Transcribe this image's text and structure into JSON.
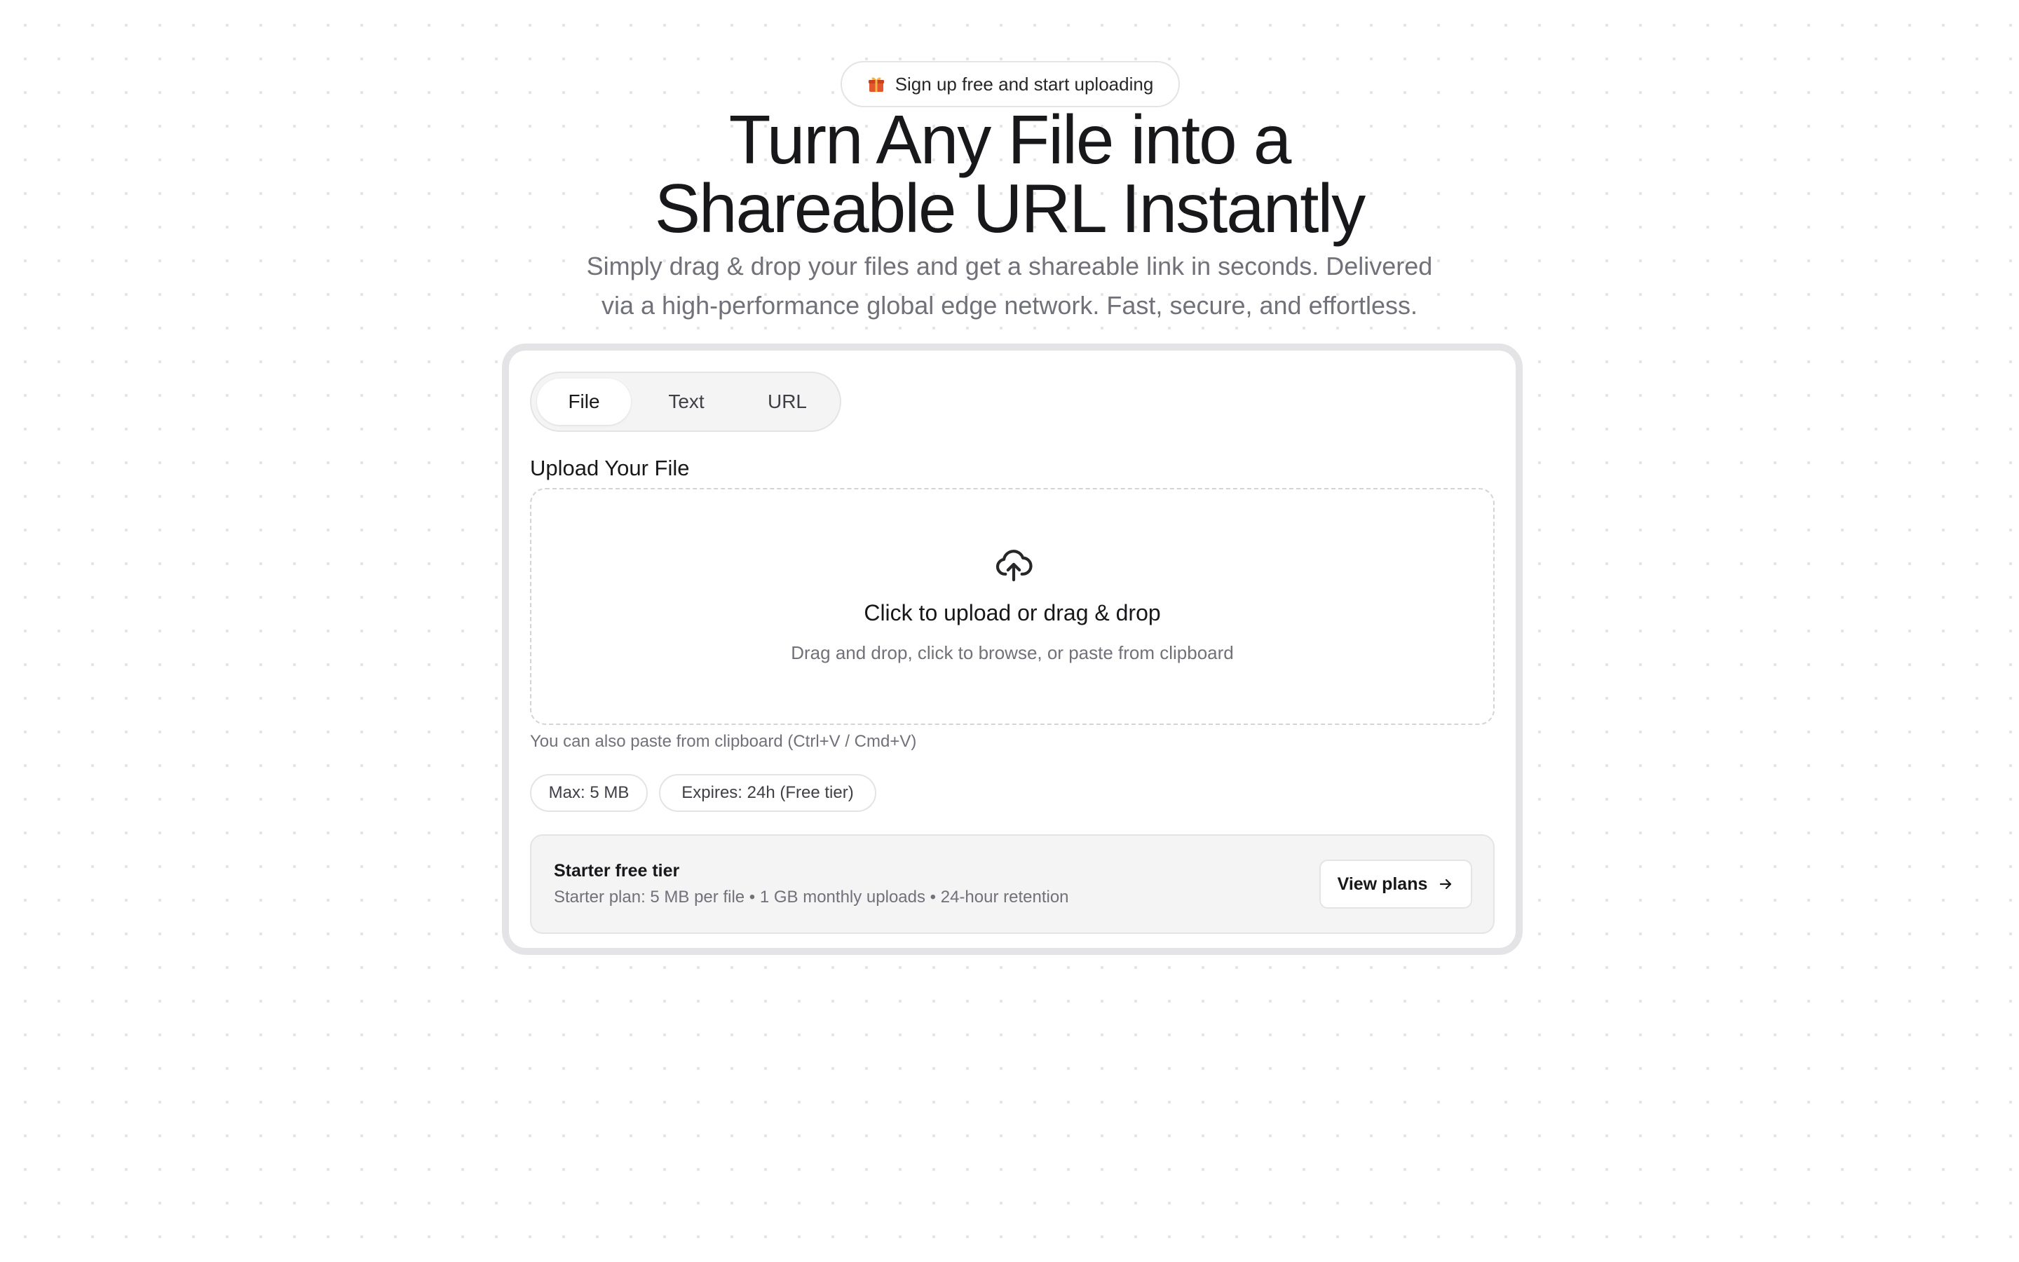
{
  "promo": {
    "icon": "gift-icon",
    "label": "Sign up free and start uploading"
  },
  "hero": {
    "title_line1": "Turn Any File into a",
    "title_line2": "Shareable URL Instantly",
    "subtitle_line1": "Simply drag & drop your files and get a shareable link in seconds. Delivered",
    "subtitle_line2": "via a high-performance global edge network. Fast, secure, and effortless."
  },
  "tabs": [
    {
      "label": "File",
      "active": true
    },
    {
      "label": "Text",
      "active": false
    },
    {
      "label": "URL",
      "active": false
    }
  ],
  "upload": {
    "section_label": "Upload Your File",
    "icon": "cloud-upload-icon",
    "title": "Click to upload or drag & drop",
    "subtitle": "Drag and drop, click to browse, or paste from clipboard",
    "hint": "You can also paste from clipboard (Ctrl+V / Cmd+V)"
  },
  "limits": {
    "max_size": "Max: 5 MB",
    "expires": "Expires: 24h (Free tier)"
  },
  "tier": {
    "title": "Starter free tier",
    "description": "Starter plan: 5 MB per file • 1 GB monthly uploads • 24-hour retention",
    "button_label": "View plans",
    "button_icon": "arrow-right-icon"
  },
  "colors": {
    "text": "#18181b",
    "muted": "#71717a",
    "border": "#e4e4e7",
    "surface": "#f4f4f5",
    "gift_red": "#e4572e",
    "gift_ribbon": "#f5b642"
  }
}
